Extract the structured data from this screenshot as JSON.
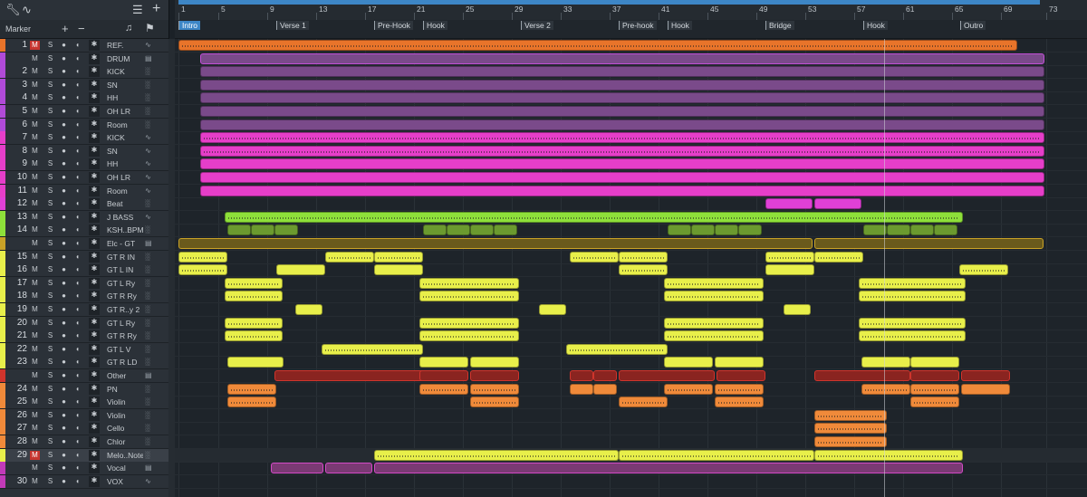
{
  "toolbar": {
    "wrench_icon": "wrench-icon",
    "curve_icon": "automation-curve-icon",
    "list_icon": "list-menu-icon",
    "add_icon": "plus-icon"
  },
  "marker_bar": {
    "label": "Marker",
    "add": "+",
    "remove": "−",
    "note_icon": "music-note-icon",
    "flag_icon": "flag-icon"
  },
  "ruler": {
    "ticks": [
      "1",
      "5",
      "9",
      "13",
      "17",
      "21",
      "25",
      "29",
      "33",
      "37",
      "41",
      "45",
      "49",
      "53",
      "57",
      "61",
      "65",
      "69",
      "73"
    ]
  },
  "markers": [
    "Intro",
    "Verse 1",
    "Pre-Hook",
    "Hook",
    "Verse 2",
    "Pre-hook",
    "Hook",
    "Bridge",
    "Hook",
    "Outro"
  ],
  "tracks": [
    {
      "num": "1",
      "name": "REF.",
      "color": "#e8742a",
      "mute_active": true,
      "type": "audio"
    },
    {
      "num": "",
      "name": "DRUM",
      "color": "#b04ad8",
      "mute_active": false,
      "type": "folder"
    },
    {
      "num": "2",
      "name": "KICK",
      "color": "#b04ad8",
      "mute_active": false,
      "type": "midi"
    },
    {
      "num": "3",
      "name": "SN",
      "color": "#b04ad8",
      "mute_active": false,
      "type": "midi"
    },
    {
      "num": "4",
      "name": "HH",
      "color": "#b04ad8",
      "mute_active": false,
      "type": "midi"
    },
    {
      "num": "5",
      "name": "OH LR",
      "color": "#b04ad8",
      "mute_active": false,
      "type": "midi"
    },
    {
      "num": "6",
      "name": "Room",
      "color": "#b04ad8",
      "mute_active": false,
      "type": "midi"
    },
    {
      "num": "7",
      "name": "KICK",
      "color": "#e63ec9",
      "mute_active": false,
      "type": "audio"
    },
    {
      "num": "8",
      "name": "SN",
      "color": "#e63ec9",
      "mute_active": false,
      "type": "audio"
    },
    {
      "num": "9",
      "name": "HH",
      "color": "#e63ec9",
      "mute_active": false,
      "type": "audio"
    },
    {
      "num": "10",
      "name": "OH LR",
      "color": "#e63ec9",
      "mute_active": false,
      "type": "audio"
    },
    {
      "num": "11",
      "name": "Room",
      "color": "#e63ec9",
      "mute_active": false,
      "type": "audio"
    },
    {
      "num": "12",
      "name": "Beat",
      "color": "#e040d6",
      "mute_active": false,
      "type": "midi"
    },
    {
      "num": "13",
      "name": "J BASS",
      "color": "#8ee03a",
      "mute_active": false,
      "type": "audio"
    },
    {
      "num": "14",
      "name": "KSH..BPM",
      "color": "#8ee03a",
      "mute_active": false,
      "type": "midi"
    },
    {
      "num": "",
      "name": "Elc - GT",
      "color": "#c9a227",
      "mute_active": false,
      "type": "folder"
    },
    {
      "num": "15",
      "name": "GT R IN",
      "color": "#e8ef4a",
      "mute_active": false,
      "type": "midi"
    },
    {
      "num": "16",
      "name": "GT L IN",
      "color": "#e8ef4a",
      "mute_active": false,
      "type": "midi"
    },
    {
      "num": "17",
      "name": "GT L Ry",
      "color": "#e8ef4a",
      "mute_active": false,
      "type": "midi"
    },
    {
      "num": "18",
      "name": "GT R Ry",
      "color": "#e8ef4a",
      "mute_active": false,
      "type": "midi"
    },
    {
      "num": "19",
      "name": "GT R..y 2",
      "color": "#e8ef4a",
      "mute_active": false,
      "type": "midi"
    },
    {
      "num": "20",
      "name": "GT L Ry",
      "color": "#e8ef4a",
      "mute_active": false,
      "type": "midi"
    },
    {
      "num": "21",
      "name": "GT R Ry",
      "color": "#e8ef4a",
      "mute_active": false,
      "type": "midi"
    },
    {
      "num": "22",
      "name": "GT L V",
      "color": "#e8ef4a",
      "mute_active": false,
      "type": "midi"
    },
    {
      "num": "23",
      "name": "GT R LD",
      "color": "#e8ef4a",
      "mute_active": false,
      "type": "midi"
    },
    {
      "num": "",
      "name": "Other",
      "color": "#d0342c",
      "mute_active": false,
      "type": "folder"
    },
    {
      "num": "24",
      "name": "PN",
      "color": "#f08a3a",
      "mute_active": false,
      "type": "midi"
    },
    {
      "num": "25",
      "name": "Violin",
      "color": "#f08a3a",
      "mute_active": false,
      "type": "midi"
    },
    {
      "num": "26",
      "name": "Violin",
      "color": "#f08a3a",
      "mute_active": false,
      "type": "midi"
    },
    {
      "num": "27",
      "name": "Cello",
      "color": "#f08a3a",
      "mute_active": false,
      "type": "midi"
    },
    {
      "num": "28",
      "name": "Chlor",
      "color": "#f08a3a",
      "mute_active": false,
      "type": "midi"
    },
    {
      "num": "29",
      "name": "Melo..Note",
      "color": "#e8ef4a",
      "mute_active": true,
      "type": "midi"
    },
    {
      "num": "",
      "name": "Vocal",
      "color": "#c23ab8",
      "mute_active": false,
      "type": "folder"
    },
    {
      "num": "30",
      "name": "VOX",
      "color": "#c23ab8",
      "mute_active": false,
      "type": "audio"
    }
  ],
  "colors": {
    "orange": "#e8742a",
    "purple": "#7a4a8a",
    "pink": "#e63ec9",
    "magenta": "#e040d6",
    "green": "#8ee03a",
    "gold": "#c9a227",
    "yellow": "#e8ef4a",
    "red": "#b8302b",
    "lightorange": "#f08a3a",
    "vocal": "#7a3a74"
  }
}
